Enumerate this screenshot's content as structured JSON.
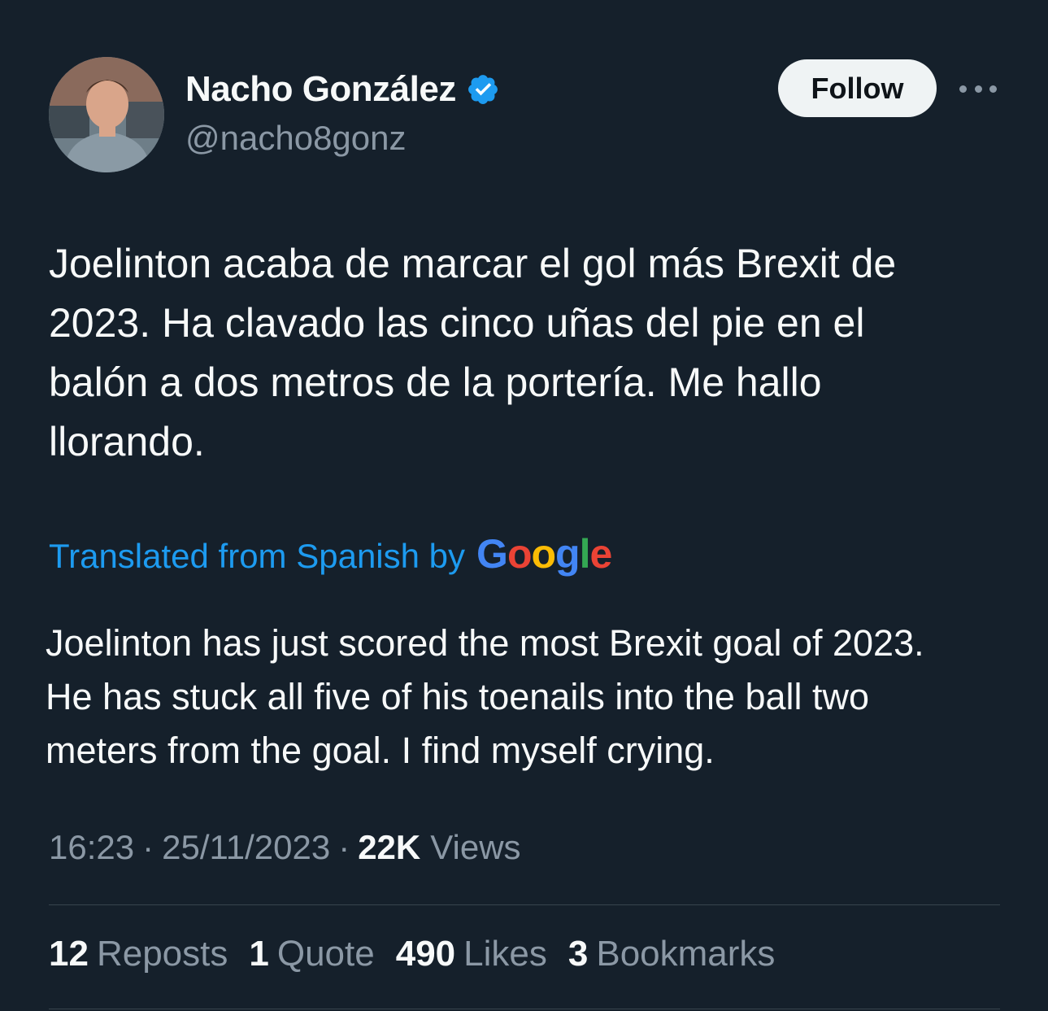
{
  "user": {
    "display_name": "Nacho González",
    "handle": "@nacho8gonz",
    "verified": true
  },
  "header": {
    "follow_label": "Follow",
    "more_icon": "more-icon"
  },
  "tweet": {
    "text": "Joelinton acaba de marcar el gol más Brexit de\n2023. Ha clavado las cinco uñas del pie en el\nbalón a dos metros de la portería. Me hallo\nllorando.",
    "translated_label": "Translated from Spanish by",
    "translation_provider": [
      "G",
      "o",
      "o",
      "g",
      "l",
      "e"
    ],
    "translation": "Joelinton has just scored the most Brexit goal of 2023.\nHe has stuck all five of his toenails into the ball two\nmeters from the goal. I find myself crying."
  },
  "meta": {
    "time": "16:23",
    "date": "25/11/2023",
    "separator": "·",
    "views_count": "22K",
    "views_label": "Views"
  },
  "stats": [
    {
      "count": "12",
      "label": "Reposts"
    },
    {
      "count": "1",
      "label": "Quote"
    },
    {
      "count": "490",
      "label": "Likes"
    },
    {
      "count": "3",
      "label": "Bookmarks"
    }
  ],
  "colors": {
    "background": "#15202b",
    "link": "#1d9bf0",
    "verified": "#1d9bf0",
    "secondary_text": "#8b98a5"
  }
}
